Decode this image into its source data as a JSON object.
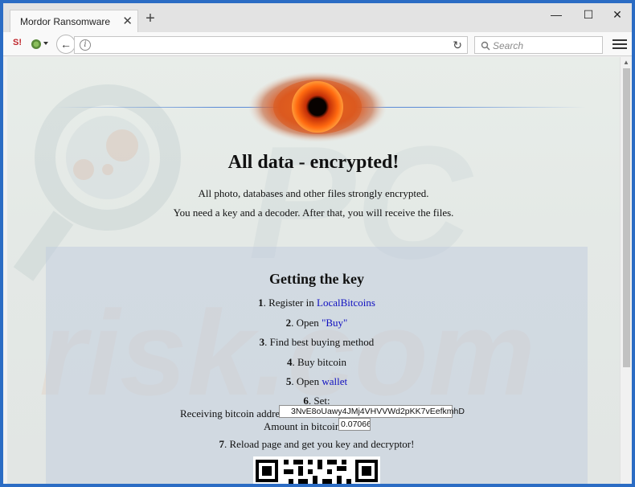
{
  "browser": {
    "tab_title": "Mordor Ransomware",
    "tab_close": "✕",
    "new_tab": "+",
    "minimize": "—",
    "maximize": "☐",
    "close": "✕",
    "ext1": "S!",
    "ext2_icon": "tor-onion-icon",
    "back": "←",
    "info": "i",
    "reload": "↻",
    "search_icon": "⌕",
    "search_placeholder": "Search",
    "url": ""
  },
  "page": {
    "title": "All data - encrypted!",
    "line1": "All photo, databases and other files strongly encrypted.",
    "line2": "You need a key and a decoder. After that, you will receive the files.",
    "section_title": "Getting the key",
    "steps": [
      {
        "num": "1",
        "text": ". Register in ",
        "link": "LocalBitcoins",
        "after": ""
      },
      {
        "num": "2",
        "text": ". Open ",
        "link": "\"Buy\"",
        "after": ""
      },
      {
        "num": "3",
        "text": ". Find best buying method",
        "link": "",
        "after": ""
      },
      {
        "num": "4",
        "text": ". Buy bitcoin",
        "link": "",
        "after": ""
      },
      {
        "num": "5",
        "text": ". Open ",
        "link": "wallet",
        "after": ""
      },
      {
        "num": "6",
        "text": ". Set:",
        "link": "",
        "after": ""
      },
      {
        "num": "7",
        "text": ". Reload page and get you key and decryptor!",
        "link": "",
        "after": ""
      }
    ],
    "address_label": "Receiving bitcoin address:",
    "address_value": "3NvE8oUawy4JMj4VHVVWd2pKK7vEefkmhD",
    "amount_label": "Amount in bitcoins:",
    "amount_value": "0.07066:"
  },
  "colors": {
    "link": "#1010c0",
    "frame": "#2b6cc4"
  }
}
